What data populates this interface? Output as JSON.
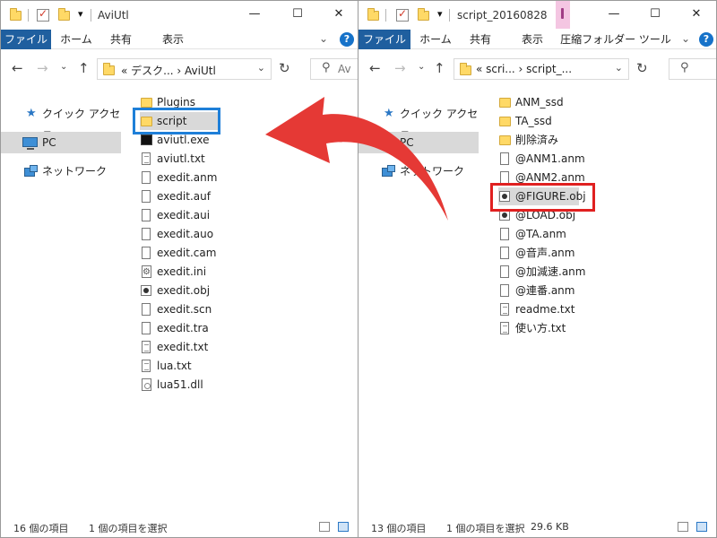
{
  "left": {
    "title": "AviUtl",
    "ribbon_tabs": [
      "ファイル",
      "ホーム",
      "共有",
      "表示"
    ],
    "address": "« デスク...  ›  AviUtl",
    "search_placeholder": "Av",
    "sidebar": [
      "クイック アクセス",
      "PC",
      "ネットワーク"
    ],
    "files": [
      {
        "name": "Plugins",
        "icon": "folder-icon"
      },
      {
        "name": "script",
        "icon": "folder-icon"
      },
      {
        "name": "aviutl.exe",
        "icon": "exe-icon"
      },
      {
        "name": "aviutl.txt",
        "icon": "text-file-icon"
      },
      {
        "name": "exedit.anm",
        "icon": "file-icon"
      },
      {
        "name": "exedit.auf",
        "icon": "file-icon"
      },
      {
        "name": "exedit.aui",
        "icon": "file-icon"
      },
      {
        "name": "exedit.auo",
        "icon": "file-icon"
      },
      {
        "name": "exedit.cam",
        "icon": "file-icon"
      },
      {
        "name": "exedit.ini",
        "icon": "settings-file-icon"
      },
      {
        "name": "exedit.obj",
        "icon": "obj-file-icon"
      },
      {
        "name": "exedit.scn",
        "icon": "file-icon"
      },
      {
        "name": "exedit.tra",
        "icon": "file-icon"
      },
      {
        "name": "exedit.txt",
        "icon": "text-file-icon"
      },
      {
        "name": "lua.txt",
        "icon": "text-file-icon"
      },
      {
        "name": "lua51.dll",
        "icon": "dll-file-icon"
      }
    ],
    "status_count": "16 個の項目",
    "status_selected": "1 個の項目を選択"
  },
  "right": {
    "title": "script_20160828",
    "ribbon_tabs": [
      "ファイル",
      "ホーム",
      "共有",
      "表示",
      "圧縮フォルダー ツール"
    ],
    "address": "«  scri...  ›  script_...",
    "files": [
      {
        "name": "ANM_ssd",
        "icon": "folder-icon"
      },
      {
        "name": "TA_ssd",
        "icon": "folder-icon"
      },
      {
        "name": "削除済み",
        "icon": "folder-icon"
      },
      {
        "name": "@ANM1.anm",
        "icon": "file-icon"
      },
      {
        "name": "@ANM2.anm",
        "icon": "file-icon"
      },
      {
        "name": "@FIGURE.obj",
        "icon": "obj-file-icon"
      },
      {
        "name": "@LOAD.obj",
        "icon": "obj-file-icon"
      },
      {
        "name": "@TA.anm",
        "icon": "file-icon"
      },
      {
        "name": "@音声.anm",
        "icon": "file-icon"
      },
      {
        "name": "@加減速.anm",
        "icon": "file-icon"
      },
      {
        "name": "@連番.anm",
        "icon": "file-icon"
      },
      {
        "name": "readme.txt",
        "icon": "text-file-icon"
      },
      {
        "name": "使い方.txt",
        "icon": "text-file-icon"
      }
    ],
    "status_count": "13 個の項目",
    "status_selected": "1 個の項目を選択",
    "status_size": "29.6 KB"
  },
  "colors": {
    "highlight_left": "#1e7fd8",
    "highlight_right": "#e02020",
    "arrow": "#e53935",
    "ribbon_file_tab": "#1f5f9f"
  }
}
